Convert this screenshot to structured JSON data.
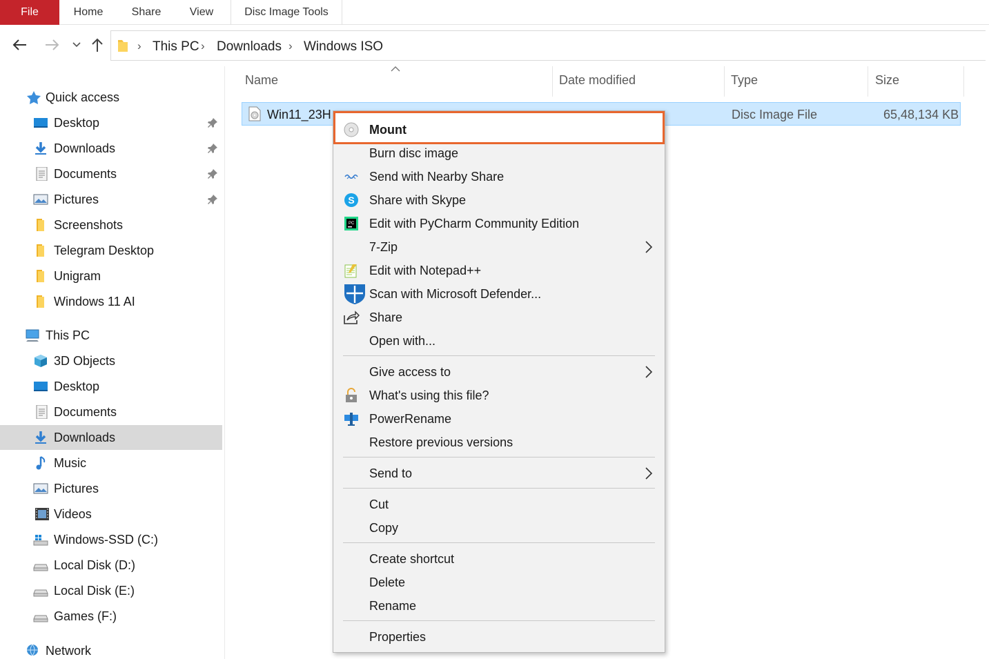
{
  "ribbon": {
    "tabs": [
      "File",
      "Home",
      "Share",
      "View",
      "Disc Image Tools"
    ]
  },
  "address": {
    "crumbs": [
      "This PC",
      "Downloads",
      "Windows ISO"
    ]
  },
  "sidebar": {
    "quick_access": "Quick access",
    "quick_items": [
      "Desktop",
      "Downloads",
      "Documents",
      "Pictures",
      "Screenshots",
      "Telegram Desktop",
      "Unigram",
      "Windows 11 AI"
    ],
    "this_pc": "This PC",
    "pc_items": [
      "3D Objects",
      "Desktop",
      "Documents",
      "Downloads",
      "Music",
      "Pictures",
      "Videos",
      "Windows-SSD (C:)",
      "Local Disk (D:)",
      "Local Disk (E:)",
      "Games (F:)"
    ],
    "network": "Network"
  },
  "columns": {
    "name": "Name",
    "date": "Date modified",
    "type": "Type",
    "size": "Size"
  },
  "file": {
    "name": "Win11_23H",
    "type": "Disc Image File",
    "size": "65,48,134 KB"
  },
  "context_menu": {
    "items": [
      "Mount",
      "Burn disc image",
      "Send with Nearby Share",
      "Share with Skype",
      "Edit with PyCharm Community Edition",
      "7-Zip",
      "Edit with Notepad++",
      "Scan with Microsoft Defender...",
      "Share",
      "Open with...",
      "Give access to",
      "What's using this file?",
      "PowerRename",
      "Restore previous versions",
      "Send to",
      "Cut",
      "Copy",
      "Create shortcut",
      "Delete",
      "Rename",
      "Properties"
    ]
  },
  "colors": {
    "file_tab": "#c4242b",
    "selection": "#cce8ff",
    "highlight_border": "#e8662e",
    "sidebar_selected": "#d9d9d9"
  }
}
